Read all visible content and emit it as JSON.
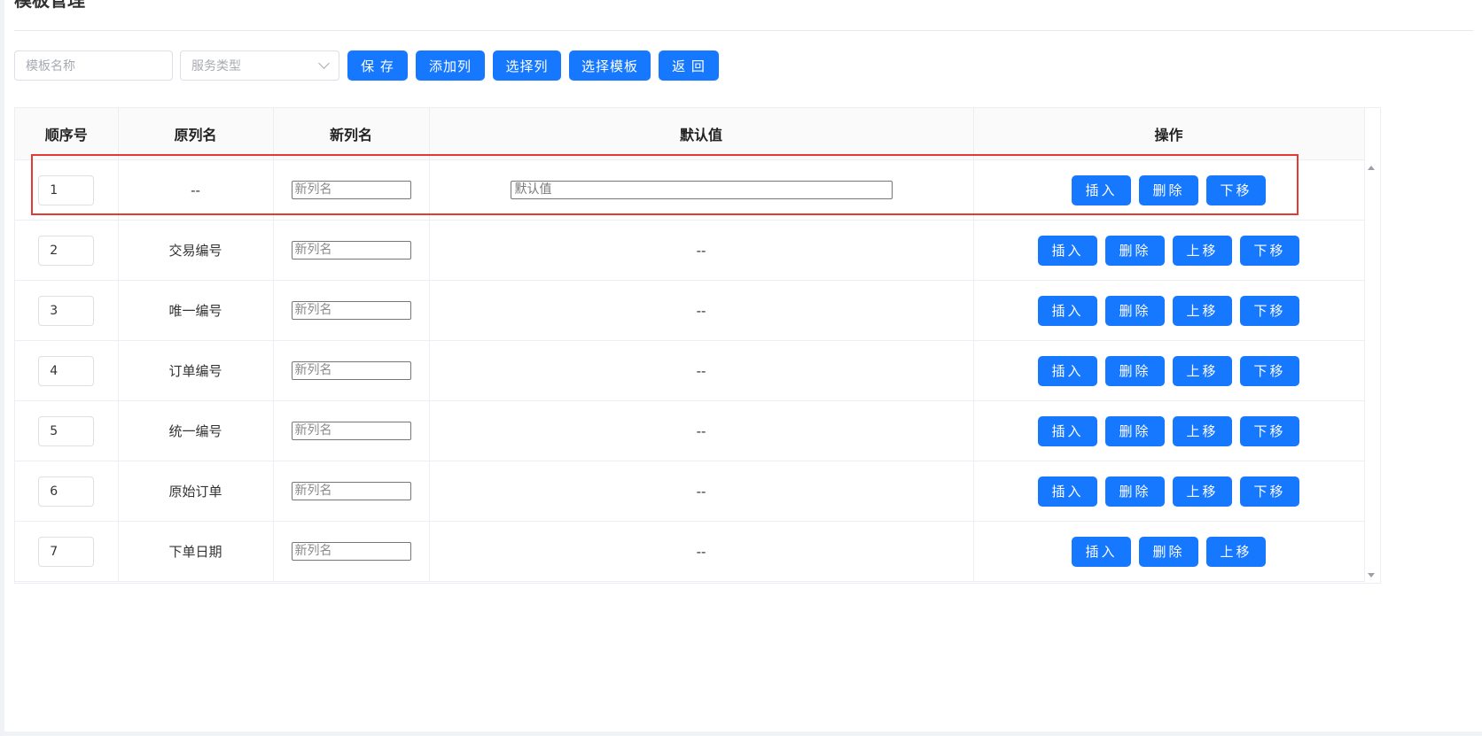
{
  "page": {
    "title": "模板管理"
  },
  "toolbar": {
    "template_name_placeholder": "模板名称",
    "service_type_placeholder": "服务类型",
    "save_label": "保 存",
    "add_column_label": "添加列",
    "select_column_label": "选择列",
    "select_template_label": "选择模板",
    "back_label": "返 回"
  },
  "table": {
    "headers": {
      "seq": "顺序号",
      "original": "原列名",
      "new_name": "新列名",
      "default": "默认值",
      "action": "操作"
    },
    "new_name_placeholder": "新列名",
    "default_placeholder": "默认值",
    "buttons": {
      "insert": "插入",
      "delete": "删除",
      "up": "上移",
      "down": "下移"
    },
    "rows": [
      {
        "seq": "1",
        "original": "--",
        "default": ""
      },
      {
        "seq": "2",
        "original": "交易编号",
        "default": "--"
      },
      {
        "seq": "3",
        "original": "唯一编号",
        "default": "--"
      },
      {
        "seq": "4",
        "original": "订单编号",
        "default": "--"
      },
      {
        "seq": "5",
        "original": "统一编号",
        "default": "--"
      },
      {
        "seq": "6",
        "original": "原始订单",
        "default": "--"
      },
      {
        "seq": "7",
        "original": "下单日期",
        "default": "--"
      }
    ]
  },
  "colors": {
    "primary": "#1677ff",
    "highlight": "#e53935"
  }
}
